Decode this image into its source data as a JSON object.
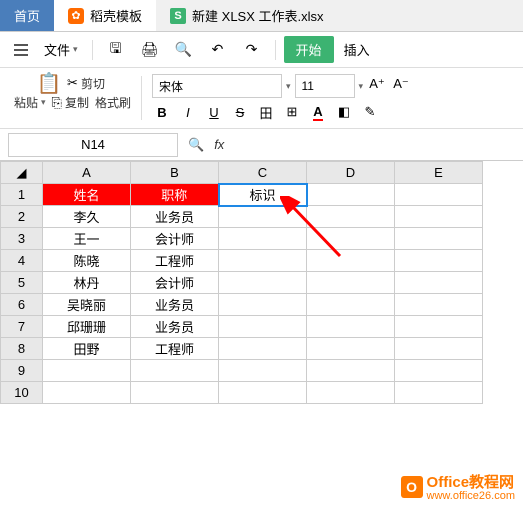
{
  "tabs": {
    "home": "首页",
    "docer": "稻壳模板",
    "workbook": "新建 XLSX 工作表.xlsx"
  },
  "menu": {
    "file": "文件",
    "start": "开始",
    "insert": "插入"
  },
  "toolbar": {
    "cut": "剪切",
    "paste": "粘贴",
    "copy": "复制",
    "format_painter": "格式刷",
    "font_name": "宋体",
    "font_size": "11"
  },
  "formula_bar": {
    "name_box": "N14",
    "fx": "fx"
  },
  "columns": [
    "A",
    "B",
    "C",
    "D",
    "E"
  ],
  "rows": [
    "1",
    "2",
    "3",
    "4",
    "5",
    "6",
    "7",
    "8",
    "9",
    "10"
  ],
  "headers_row": {
    "A": "姓名",
    "B": "职称"
  },
  "selected_cell": {
    "value": "标识"
  },
  "data_rows": [
    {
      "A": "李久",
      "B": "业务员"
    },
    {
      "A": "王一",
      "B": "会计师"
    },
    {
      "A": "陈晓",
      "B": "工程师"
    },
    {
      "A": "林丹",
      "B": "会计师"
    },
    {
      "A": "吴晓丽",
      "B": "业务员"
    },
    {
      "A": "邱珊珊",
      "B": "业务员"
    },
    {
      "A": "田野",
      "B": "工程师"
    }
  ],
  "watermark": {
    "title": "Office教程网",
    "url": "www.office26.com"
  },
  "chart_data": {
    "type": "table",
    "columns": [
      "姓名",
      "职称"
    ],
    "rows": [
      [
        "李久",
        "业务员"
      ],
      [
        "王一",
        "会计师"
      ],
      [
        "陈晓",
        "工程师"
      ],
      [
        "林丹",
        "会计师"
      ],
      [
        "吴晓丽",
        "业务员"
      ],
      [
        "邱珊珊",
        "业务员"
      ],
      [
        "田野",
        "工程师"
      ]
    ]
  }
}
